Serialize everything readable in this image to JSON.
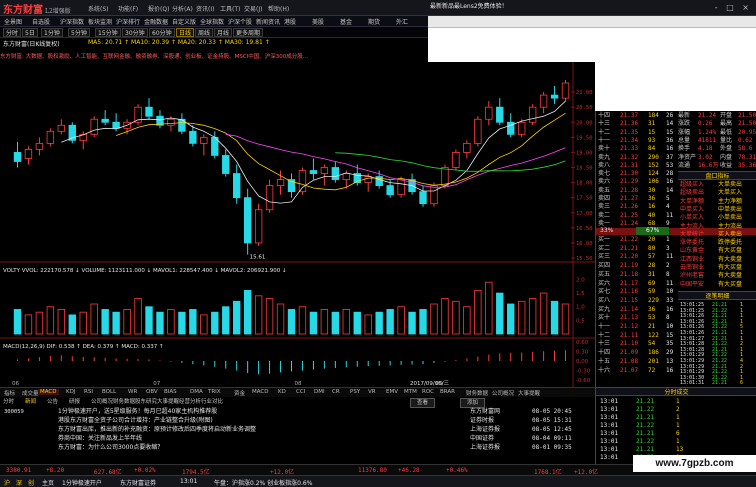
{
  "app": {
    "logo": "东方财富",
    "version": "L2增强版",
    "menu": [
      "系统(S)",
      "功能(F)",
      "报价(Q)",
      "分析(A)",
      "资讯(I)",
      "工具(T)",
      "交易(J)",
      "帮助(H)"
    ],
    "ad_text": "最新新品最Lens2免费体验！",
    "window_controls": "- □ ×"
  },
  "nav": [
    "全景图",
    "自选股",
    "沪深指数",
    "板块监测",
    "沪深排行",
    "金融数据",
    "自定义版",
    "全球指数",
    "沪深个股",
    "新闻资讯",
    "港股",
    "美股",
    "基金",
    "期货",
    "外汇"
  ],
  "periods": [
    "分时",
    "5日",
    "1分钟",
    "5分钟",
    "15分钟",
    "30分钟",
    "60分钟",
    "日线",
    "周线",
    "月线",
    "更多周期"
  ],
  "active_period": "日线",
  "stock_header": {
    "name": "东方财富(日K线复权)",
    "extra": "MA5: 20.71 ↑  MA10: 20.39 ↑  MA20: 20.33 ↑  MA30: 19.81 ↑",
    "news": "东方财富: 大数据、股权激励、人工智能、互联网金融、融资融券、深股通、创业板、证金持股、MSCI中国、沪深300成分股..."
  },
  "chart_data": {
    "type": "candlestick",
    "y_ticks": [
      "21.00",
      "20.50",
      "20.00",
      "19.50",
      "19.00",
      "18.50",
      "18.00",
      "17.50",
      "17.00",
      "16.50",
      "16.00",
      "15.50"
    ],
    "low_label": "15.61",
    "volume_label": "VOLTY VVOL: 222170.578 ↓  VOLUME: 1123111.000 ↓  MAVOL1: 228547.400 ↓  MAVOL2: 206921.900 ↓",
    "volume_ticks": [
      "2.0",
      "1.5",
      "1.0",
      "0.5"
    ],
    "macd_label": "MACD(12,26,9)  DIF: 0.538 ↑  DEA: 0.379 ↑  MACD: 0.337 ↑",
    "macd_ticks": [
      "0.60",
      "0.30",
      "0.00",
      "-0.30",
      "-0.60"
    ],
    "x_labels": [
      "06",
      "07",
      "08",
      "09"
    ],
    "date_label": "2017/09/06/三",
    "up_color": "#ff3b3b",
    "down_color": "#27d9e6",
    "ma_colors": [
      "#e8e8e8",
      "#ffd200",
      "#ff44ff",
      "#2fdc2f"
    ],
    "candles": [
      {
        "o": 19.0,
        "h": 19.35,
        "l": 18.5,
        "c": 18.7
      },
      {
        "o": 18.8,
        "h": 19.2,
        "l": 18.6,
        "c": 19.1
      },
      {
        "o": 19.1,
        "h": 19.5,
        "l": 18.9,
        "c": 19.3
      },
      {
        "o": 19.3,
        "h": 19.8,
        "l": 19.2,
        "c": 19.7
      },
      {
        "o": 19.7,
        "h": 20.1,
        "l": 19.6,
        "c": 19.9
      },
      {
        "o": 19.9,
        "h": 20.0,
        "l": 19.3,
        "c": 19.4
      },
      {
        "o": 19.4,
        "h": 19.7,
        "l": 19.1,
        "c": 19.6
      },
      {
        "o": 19.6,
        "h": 20.2,
        "l": 19.5,
        "c": 20.1
      },
      {
        "o": 20.1,
        "h": 20.4,
        "l": 19.9,
        "c": 20.0
      },
      {
        "o": 20.0,
        "h": 20.3,
        "l": 19.7,
        "c": 19.8
      },
      {
        "o": 19.8,
        "h": 20.1,
        "l": 19.6,
        "c": 20.0
      },
      {
        "o": 20.0,
        "h": 20.6,
        "l": 19.9,
        "c": 20.5
      },
      {
        "o": 20.5,
        "h": 20.8,
        "l": 20.1,
        "c": 20.2
      },
      {
        "o": 20.2,
        "h": 20.4,
        "l": 19.8,
        "c": 19.9
      },
      {
        "o": 19.9,
        "h": 20.2,
        "l": 19.7,
        "c": 20.1
      },
      {
        "o": 20.1,
        "h": 20.3,
        "l": 19.6,
        "c": 19.7
      },
      {
        "o": 19.7,
        "h": 19.9,
        "l": 19.2,
        "c": 19.3
      },
      {
        "o": 19.3,
        "h": 19.6,
        "l": 18.9,
        "c": 19.5
      },
      {
        "o": 19.5,
        "h": 19.7,
        "l": 18.8,
        "c": 18.9
      },
      {
        "o": 18.9,
        "h": 19.1,
        "l": 18.2,
        "c": 18.3
      },
      {
        "o": 18.3,
        "h": 18.6,
        "l": 17.3,
        "c": 17.5
      },
      {
        "o": 17.5,
        "h": 17.8,
        "l": 15.61,
        "c": 16.0
      },
      {
        "o": 16.0,
        "h": 17.3,
        "l": 15.9,
        "c": 17.1
      },
      {
        "o": 17.1,
        "h": 18.1,
        "l": 17.0,
        "c": 17.9
      },
      {
        "o": 17.9,
        "h": 18.4,
        "l": 17.6,
        "c": 18.1
      },
      {
        "o": 18.1,
        "h": 18.3,
        "l": 17.5,
        "c": 17.7
      },
      {
        "o": 17.7,
        "h": 18.5,
        "l": 17.6,
        "c": 18.4
      },
      {
        "o": 18.4,
        "h": 18.8,
        "l": 18.1,
        "c": 18.3
      },
      {
        "o": 18.3,
        "h": 18.6,
        "l": 17.9,
        "c": 18.5
      },
      {
        "o": 18.5,
        "h": 18.7,
        "l": 18.0,
        "c": 18.1
      },
      {
        "o": 18.1,
        "h": 18.4,
        "l": 17.8,
        "c": 18.3
      },
      {
        "o": 18.3,
        "h": 18.6,
        "l": 17.9,
        "c": 18.0
      },
      {
        "o": 18.0,
        "h": 18.3,
        "l": 17.7,
        "c": 18.2
      },
      {
        "o": 18.2,
        "h": 18.4,
        "l": 17.8,
        "c": 17.9
      },
      {
        "o": 17.9,
        "h": 18.1,
        "l": 17.5,
        "c": 17.6
      },
      {
        "o": 17.6,
        "h": 18.2,
        "l": 17.5,
        "c": 18.1
      },
      {
        "o": 18.1,
        "h": 18.3,
        "l": 17.6,
        "c": 17.7
      },
      {
        "o": 17.7,
        "h": 17.9,
        "l": 17.2,
        "c": 17.3
      },
      {
        "o": 17.3,
        "h": 18.0,
        "l": 17.2,
        "c": 17.9
      },
      {
        "o": 17.9,
        "h": 18.6,
        "l": 17.8,
        "c": 18.5
      },
      {
        "o": 18.5,
        "h": 19.1,
        "l": 18.4,
        "c": 19.0
      },
      {
        "o": 19.0,
        "h": 19.4,
        "l": 18.8,
        "c": 19.3
      },
      {
        "o": 19.3,
        "h": 20.2,
        "l": 19.2,
        "c": 20.1
      },
      {
        "o": 20.1,
        "h": 20.7,
        "l": 19.9,
        "c": 20.5
      },
      {
        "o": 20.5,
        "h": 20.8,
        "l": 19.9,
        "c": 20.0
      },
      {
        "o": 20.0,
        "h": 20.3,
        "l": 19.5,
        "c": 19.6
      },
      {
        "o": 19.6,
        "h": 20.1,
        "l": 19.5,
        "c": 20.0
      },
      {
        "o": 20.0,
        "h": 20.6,
        "l": 19.9,
        "c": 20.5
      },
      {
        "o": 20.5,
        "h": 21.0,
        "l": 20.3,
        "c": 20.9
      },
      {
        "o": 20.9,
        "h": 21.2,
        "l": 20.6,
        "c": 20.8
      },
      {
        "o": 20.8,
        "h": 21.4,
        "l": 20.7,
        "c": 21.3
      }
    ],
    "volumes": [
      0.9,
      0.7,
      0.8,
      1.0,
      0.9,
      0.7,
      0.8,
      1.1,
      0.9,
      0.8,
      0.9,
      1.3,
      1.0,
      0.8,
      0.9,
      0.8,
      0.9,
      0.7,
      0.8,
      1.0,
      1.2,
      1.6,
      1.4,
      1.3,
      1.1,
      0.9,
      1.0,
      0.8,
      0.9,
      0.8,
      0.9,
      0.8,
      0.7,
      0.8,
      0.9,
      1.0,
      0.8,
      0.9,
      1.1,
      1.3,
      1.2,
      1.0,
      1.6,
      1.9,
      1.5,
      1.1,
      1.2,
      1.3,
      1.5,
      1.2,
      1.1
    ],
    "macd": [
      0.05,
      0.08,
      0.12,
      0.16,
      0.18,
      0.15,
      0.13,
      0.12,
      0.1,
      0.08,
      0.07,
      0.06,
      0.05,
      0.02,
      -0.02,
      -0.06,
      -0.1,
      -0.14,
      -0.18,
      -0.24,
      -0.3,
      -0.38,
      -0.42,
      -0.4,
      -0.36,
      -0.33,
      -0.3,
      -0.27,
      -0.24,
      -0.22,
      -0.2,
      -0.18,
      -0.16,
      -0.15,
      -0.14,
      -0.12,
      -0.11,
      -0.1,
      -0.06,
      -0.02,
      0.03,
      0.08,
      0.14,
      0.2,
      0.24,
      0.26,
      0.27,
      0.29,
      0.31,
      0.33,
      0.34
    ]
  },
  "side": {
    "sell": [
      {
        "label": "十四",
        "price": "21.37",
        "vol": "184",
        "n": "26"
      },
      {
        "label": "十三",
        "price": "21.36",
        "vol": "31",
        "n": "14"
      },
      {
        "label": "十二",
        "price": "21.35",
        "vol": "15",
        "n": "15"
      },
      {
        "label": "十一",
        "price": "21.34",
        "vol": "93",
        "n": "36"
      },
      {
        "label": "卖十",
        "price": "21.33",
        "vol": "84",
        "n": "16"
      },
      {
        "label": "卖九",
        "price": "21.32",
        "vol": "290",
        "n": "37"
      },
      {
        "label": "卖八",
        "price": "21.31",
        "vol": "152",
        "n": "53"
      },
      {
        "label": "卖七",
        "price": "21.30",
        "vol": "124",
        "n": "28"
      },
      {
        "label": "卖六",
        "price": "21.29",
        "vol": "106",
        "n": "16"
      },
      {
        "label": "卖五",
        "price": "21.28",
        "vol": "30",
        "n": "14"
      },
      {
        "label": "卖四",
        "price": "21.27",
        "vol": "36",
        "n": "5"
      },
      {
        "label": "卖三",
        "price": "21.26",
        "vol": "16",
        "n": "4"
      },
      {
        "label": "卖二",
        "price": "21.25",
        "vol": "40",
        "n": "11"
      },
      {
        "label": "卖一",
        "price": "21.24",
        "vol": "68",
        "n": "9"
      }
    ],
    "ratio_left": "33%",
    "ratio_right": "67%",
    "buy": [
      {
        "label": "买一",
        "price": "21.22",
        "vol": "20",
        "n": "1"
      },
      {
        "label": "买二",
        "price": "21.21",
        "vol": "80",
        "n": "3"
      },
      {
        "label": "买三",
        "price": "21.20",
        "vol": "57",
        "n": "11"
      },
      {
        "label": "买四",
        "price": "21.19",
        "vol": "28",
        "n": "2"
      },
      {
        "label": "买五",
        "price": "21.18",
        "vol": "31",
        "n": "8"
      },
      {
        "label": "买六",
        "price": "21.17",
        "vol": "69",
        "n": "11"
      },
      {
        "label": "买七",
        "price": "21.16",
        "vol": "59",
        "n": "10"
      },
      {
        "label": "买八",
        "price": "21.15",
        "vol": "229",
        "n": "33"
      },
      {
        "label": "买九",
        "price": "21.14",
        "vol": "36",
        "n": "16"
      },
      {
        "label": "买十",
        "price": "21.13",
        "vol": "53",
        "n": "8"
      },
      {
        "label": "十一",
        "price": "21.12",
        "vol": "21",
        "n": "10"
      },
      {
        "label": "十二",
        "price": "21.11",
        "vol": "122",
        "n": "15"
      },
      {
        "label": "十三",
        "price": "21.10",
        "vol": "54",
        "n": "35"
      },
      {
        "label": "十四",
        "price": "21.09",
        "vol": "186",
        "n": "29"
      },
      {
        "label": "十五",
        "price": "21.08",
        "vol": "201",
        "n": "13"
      },
      {
        "label": "十六",
        "price": "21.07",
        "vol": "72",
        "n": "16"
      }
    ],
    "quote": [
      {
        "k": "最新",
        "v": "21.24",
        "k2": "开盘",
        "v2": "21.50"
      },
      {
        "k": "涨跌",
        "v": "0.26",
        "k2": "最高",
        "v2": "21.50"
      },
      {
        "k": "涨幅",
        "v": "1.24%",
        "k2": "最低",
        "v2": "20.95"
      },
      {
        "k": "总量",
        "v": "41811",
        "k2": "量比",
        "v2": "0.62"
      },
      {
        "k": "换手",
        "v": "4.18",
        "k2": "外盘",
        "v2": "58.6"
      },
      {
        "k": "净资产",
        "v": "3.02",
        "k2": "内盘",
        "v2": "78.31%"
      },
      {
        "k": "流通",
        "v": "16.6万",
        "k2": "收益",
        "v2": "35.36"
      }
    ],
    "quote_title": "盘口指标",
    "indicators": [
      {
        "k": "超级买入",
        "v": "大单卖出"
      },
      {
        "k": "超级卖出",
        "v": "大单买入"
      },
      {
        "k": "大单净额",
        "v": "主力净额"
      },
      {
        "k": "中单买入",
        "v": "中单卖出"
      },
      {
        "k": "小单买入",
        "v": "小单卖出"
      },
      {
        "k": "主力流入",
        "v": "主力流出"
      },
      {
        "k": "大单统计",
        "v": "买入卖出"
      },
      {
        "k": "涨停委托",
        "v": "跌停委托"
      },
      {
        "k": "山东黄金",
        "v": "有大买盘"
      },
      {
        "k": "江西铜业",
        "v": "有大卖盘"
      },
      {
        "k": "云南铜业",
        "v": "有大买盘"
      },
      {
        "k": "泸州老窖",
        "v": "有大卖盘"
      },
      {
        "k": "中国平安",
        "v": "有大买盘"
      }
    ],
    "trades_title": "逐笔明细",
    "trades": [
      {
        "t": "13:01:25",
        "p": "21.21",
        "v": "1"
      },
      {
        "t": "13:01:25",
        "p": "21.22",
        "v": "1"
      },
      {
        "t": "13:01:26",
        "p": "21.21",
        "v": "1"
      },
      {
        "t": "13:01:26",
        "p": "21.21",
        "v": "1"
      },
      {
        "t": "13:01:26",
        "p": "21.22",
        "v": "5"
      },
      {
        "t": "13:01:26",
        "p": "21.21",
        "v": "1"
      },
      {
        "t": "13:01:27",
        "p": "21.21",
        "v": "1"
      },
      {
        "t": "13:01:28",
        "p": "21.22",
        "v": "2"
      },
      {
        "t": "13:01:28",
        "p": "21.21",
        "v": "1"
      },
      {
        "t": "13:01:29",
        "p": "21.22",
        "v": "1"
      },
      {
        "t": "13:01:29",
        "p": "21.22",
        "v": "4"
      },
      {
        "t": "13:01:29",
        "p": "21.21",
        "v": "2"
      },
      {
        "t": "13:01:29",
        "p": "21.22",
        "v": "1"
      },
      {
        "t": "13:01:30",
        "p": "21.22",
        "v": "1"
      },
      {
        "t": "13:01:31",
        "p": "21.21",
        "v": "6"
      }
    ]
  },
  "tabs": [
    "指标",
    "成交量",
    "MACD",
    "KDJ",
    "RSI",
    "BOLL",
    "WR",
    "OBV",
    "BIAS",
    "DMA",
    "TRIX",
    "资金",
    "MACD",
    "KD",
    "CCI",
    "DMI",
    "CR",
    "PSY",
    "VR",
    "EMV",
    "MTM",
    "ROC",
    "BRAR",
    "财务数据",
    "公司概况",
    "大事提醒"
  ],
  "tab_active": "MACD",
  "subtabs": [
    "分时",
    "新闻",
    "公告",
    "研报",
    "公司概况",
    "财务数据",
    "股东研究",
    "大事提醒",
    "经营分析",
    "行业对比"
  ],
  "news_btn1": "查看",
  "news_btn2": "添加",
  "news": [
    {
      "code": "300059",
      "title": "1分钟极速开户，送5星级服务！每月已超40家主机构推荐股",
      "src": "东方财富网",
      "time": "08-05 20:45"
    },
    {
      "code": "",
      "title": "港股东方财富全资子公司合计增持：产业链整合升级(附图)",
      "src": "证券时报",
      "time": "08-05 15:31"
    },
    {
      "code": "",
      "title": "东方财富出库，推出新的补充融资：原预计修改后四季度将启动新业务调整",
      "src": "上海证券报",
      "time": "08-05 12:45"
    },
    {
      "code": "",
      "title": "券商中国：关注新品发上半年线",
      "src": "中国证券",
      "time": "08-04 09:11"
    },
    {
      "code": "",
      "title": "东方财富：为什么公司3000点要收缩？",
      "src": "上海证券报",
      "time": "08-01 09:35"
    }
  ],
  "trade_title": "分时成交",
  "trade_rows": [
    {
      "t": "13:01",
      "p": "21.21",
      "v": "1"
    },
    {
      "t": "13:01",
      "p": "21.22",
      "v": "2"
    },
    {
      "t": "13:01",
      "p": "21.21",
      "v": "1"
    },
    {
      "t": "13:01",
      "p": "21.22",
      "v": "1"
    },
    {
      "t": "13:01",
      "p": "21.21",
      "v": "6"
    },
    {
      "t": "13:01",
      "p": "21.22",
      "v": "1"
    },
    {
      "t": "13:01",
      "p": "21.21",
      "v": "13"
    },
    {
      "t": "13:01",
      "p": "21.22",
      "v": "1"
    }
  ],
  "indices": [
    {
      "v": "3380.91",
      "c": "+8.20"
    },
    {
      "v": "627.68亿",
      "c": "+0.02%"
    },
    {
      "v": "1794.5亿",
      "c": ""
    },
    {
      "v": "+12.0亿",
      "c": ""
    },
    {
      "v": "11376.80",
      "c": "+46.28"
    },
    {
      "v": "+0.46%",
      "c": ""
    },
    {
      "v": "1768.1亿",
      "c": "+12.0亿"
    }
  ],
  "status": [
    "沪",
    "深",
    "创",
    "主页",
    "1分钟极速开户",
    "东方财富证券",
    "13:01",
    "午盘：沪指涨0.2% 创业板指涨0.6%"
  ],
  "watermark": "www.7gpzb.com"
}
